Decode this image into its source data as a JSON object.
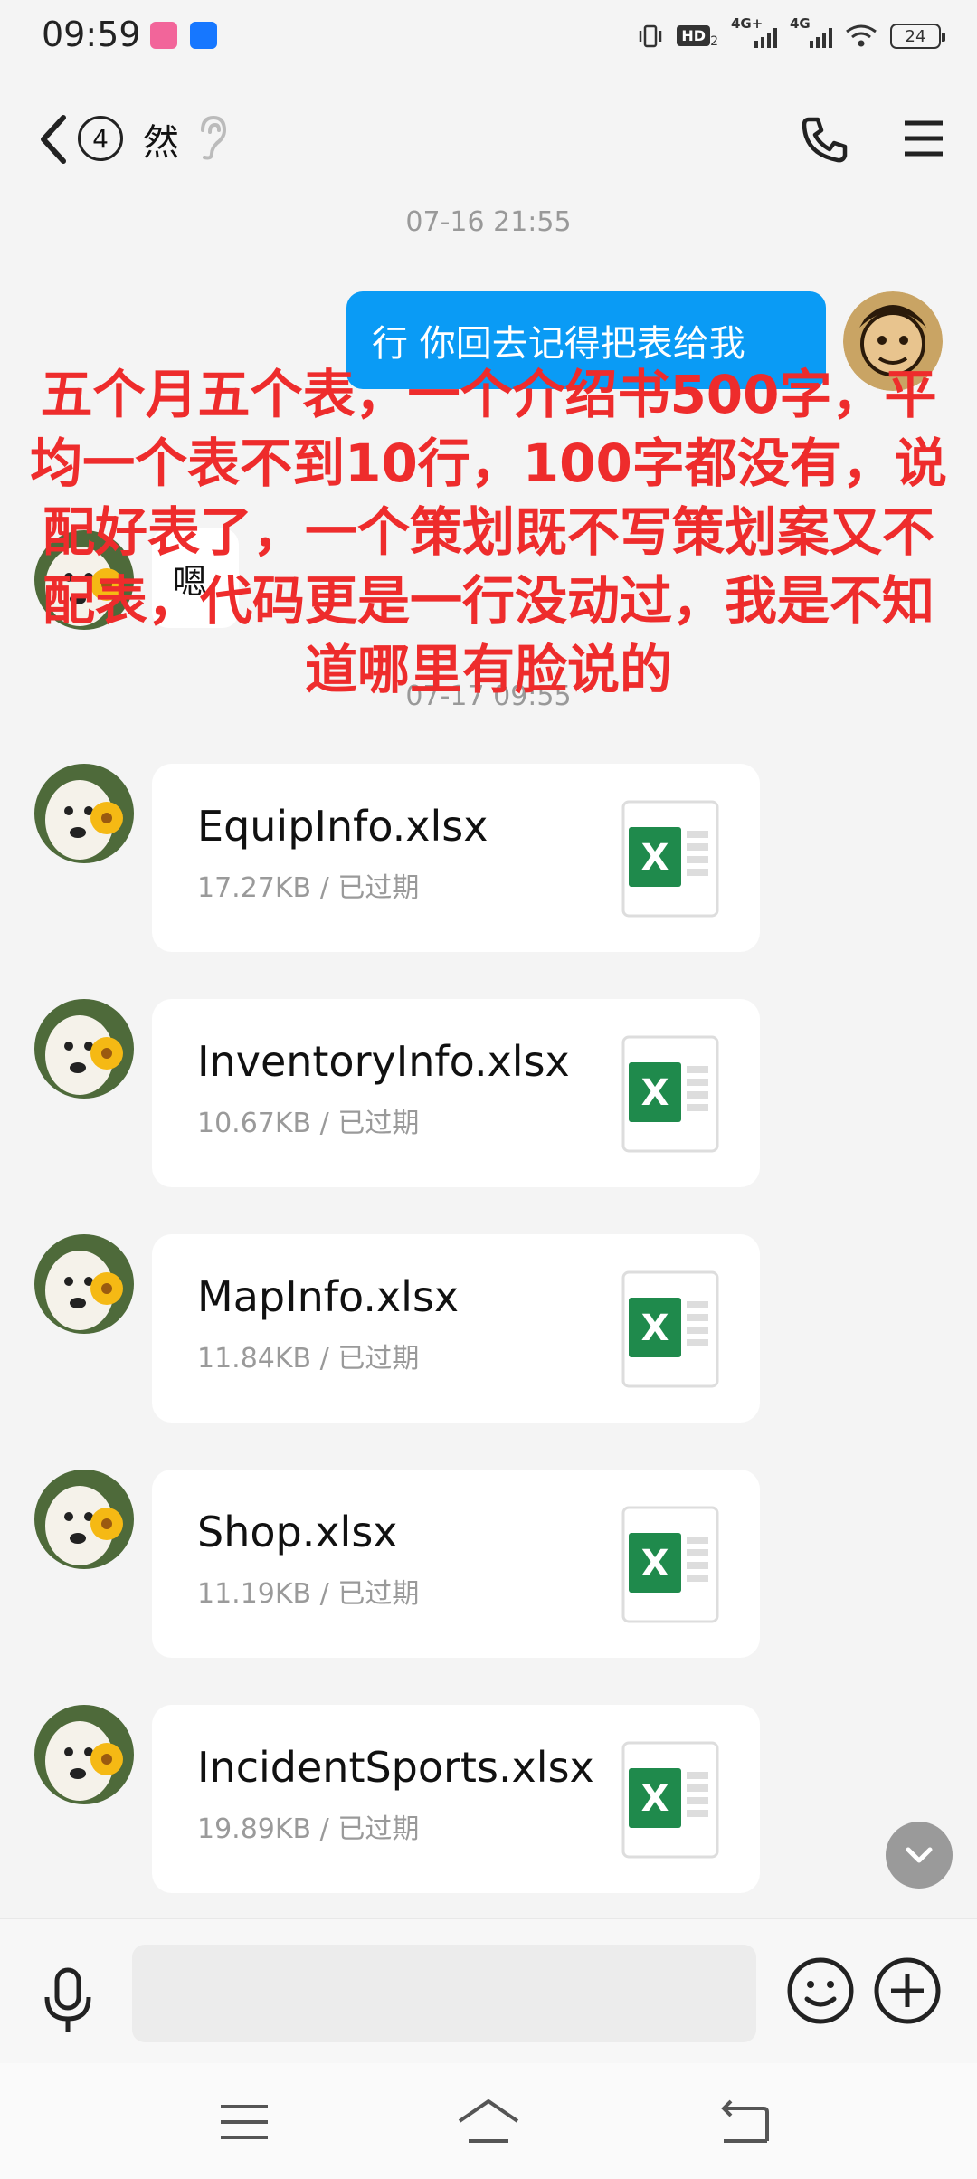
{
  "status_bar": {
    "time": "09:59",
    "hd_label": "HD",
    "hd_sub": "2",
    "sim1_label": "4G+",
    "sim2_label": "4G",
    "battery": "24"
  },
  "header": {
    "unread_count": "4",
    "contact_name": "然"
  },
  "chat": {
    "timestamp_1": "07-16 21:55",
    "outgoing_message": "行 你回去记得把表给我",
    "incoming_message": "嗯,",
    "timestamp_2": "07-17 09:55",
    "files": [
      {
        "name": "EquipInfo.xlsx",
        "meta": "17.27KB / 已过期"
      },
      {
        "name": "InventoryInfo.xlsx",
        "meta": "10.67KB / 已过期"
      },
      {
        "name": "MapInfo.xlsx",
        "meta": "11.84KB / 已过期"
      },
      {
        "name": "Shop.xlsx",
        "meta": "11.19KB / 已过期"
      },
      {
        "name": "IncidentSports.xlsx",
        "meta": "19.89KB / 已过期"
      }
    ]
  },
  "overlay_text": "五个月五个表，一个介绍书500字，平均一个表不到10行，100字都没有，说配好表了，一个策划既不写策划案又不配表，代码更是一行没动过，我是不知道哪里有脸说的",
  "input": {
    "placeholder": ""
  },
  "colors": {
    "accent": "#0a9bf5",
    "overlay_red": "#ee2c2c",
    "excel_green": "#1f8a4c"
  }
}
